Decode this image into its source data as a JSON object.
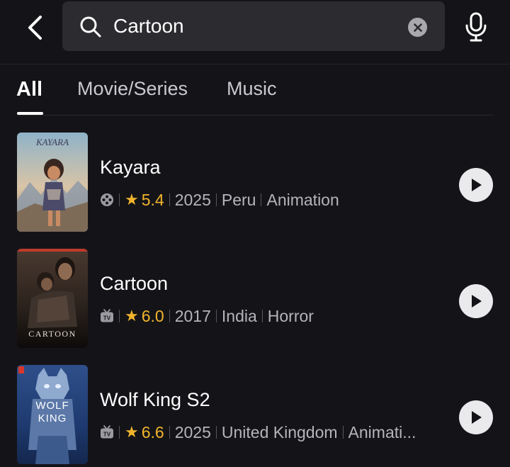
{
  "search": {
    "value": "Cartoon",
    "placeholder": "Search"
  },
  "tabs": [
    {
      "label": "All",
      "active": true
    },
    {
      "label": "Movie/Series",
      "active": false
    },
    {
      "label": "Music",
      "active": false
    }
  ],
  "results": [
    {
      "title": "Kayara",
      "type_icon": "film-reel-icon",
      "rating": "5.4",
      "year": "2025",
      "country": "Peru",
      "genre": "Animation",
      "poster_text": "KAYARA"
    },
    {
      "title": "Cartoon",
      "type_icon": "tv-icon",
      "rating": "6.0",
      "year": "2017",
      "country": "India",
      "genre": "Horror",
      "poster_text": "CARTOON"
    },
    {
      "title": "Wolf King S2",
      "type_icon": "tv-icon",
      "rating": "6.6",
      "year": "2025",
      "country": "United Kingdom",
      "genre": "Animati...",
      "poster_text_line1": "WOLF",
      "poster_text_line2": "KING"
    }
  ],
  "colors": {
    "background": "#141418",
    "search_box": "#2c2c30",
    "rating": "#f2b52c",
    "meta_text": "#b4b4ba"
  }
}
